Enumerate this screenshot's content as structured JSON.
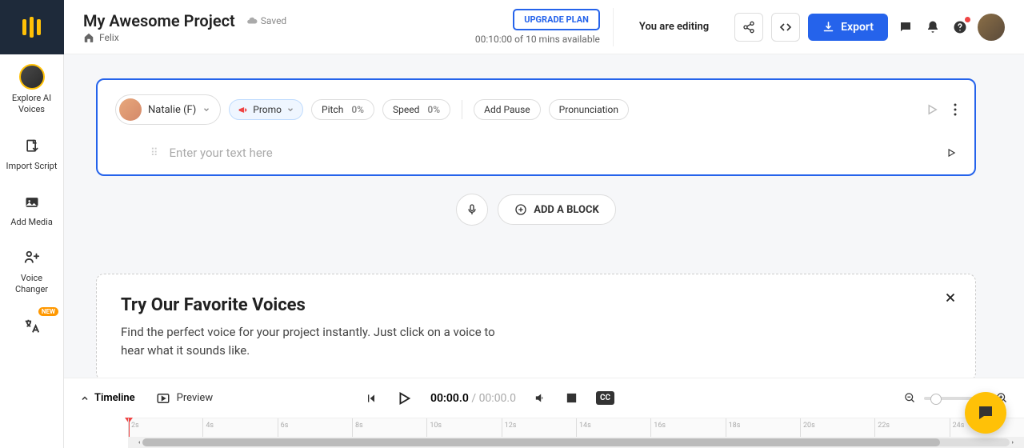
{
  "project": {
    "title": "My Awesome Project",
    "saved_label": "Saved",
    "home_label": "Felix"
  },
  "header": {
    "upgrade": "UPGRADE PLAN",
    "time_available": "00:10:00 of 10 mins available",
    "editing": "You are editing",
    "export": "Export"
  },
  "sidebar": {
    "items": [
      {
        "label": "Explore AI Voices"
      },
      {
        "label": "Import Script"
      },
      {
        "label": "Add Media"
      },
      {
        "label": "Voice Changer"
      },
      {
        "label": "",
        "badge": "NEW"
      }
    ]
  },
  "block": {
    "voice": "Natalie (F)",
    "style": "Promo",
    "pitch_label": "Pitch",
    "pitch_val": "0%",
    "speed_label": "Speed",
    "speed_val": "0%",
    "pause": "Add Pause",
    "pron": "Pronunciation",
    "placeholder": "Enter your text here"
  },
  "add_block": "ADD A BLOCK",
  "voices_panel": {
    "title": "Try Our Favorite Voices",
    "desc": "Find the perfect voice for your project instantly. Just click on a voice to hear what it sounds like."
  },
  "bottombar": {
    "timeline": "Timeline",
    "preview": "Preview",
    "current": "00:00.0",
    "total": "00:00.0"
  },
  "ruler": [
    "2s",
    "4s",
    "6s",
    "8s",
    "10s",
    "12s",
    "14s",
    "16s",
    "18s",
    "20s",
    "22s",
    "24s"
  ]
}
